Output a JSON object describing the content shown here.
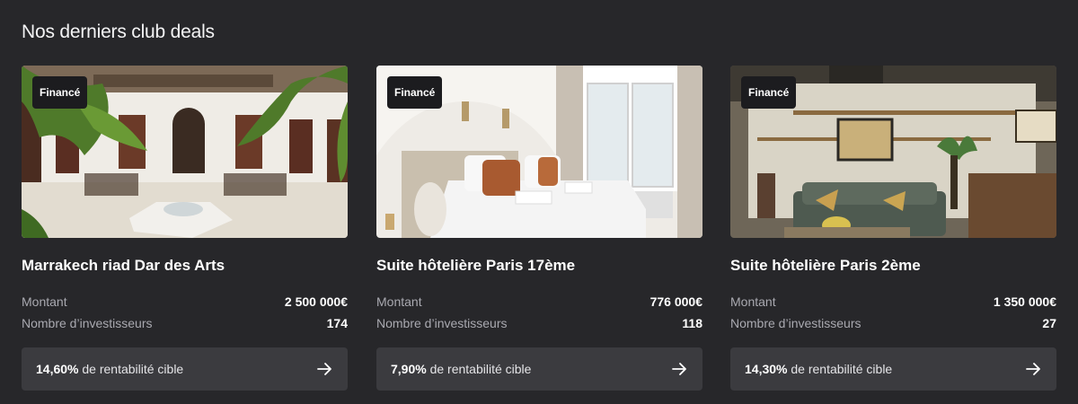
{
  "section": {
    "title": "Nos derniers club deals"
  },
  "labels": {
    "amount": "Montant",
    "investors": "Nombre d’investisseurs",
    "return_suffix": "de rentabilité cible"
  },
  "cards": [
    {
      "badge": "Financé",
      "title": "Marrakech riad Dar des Arts",
      "amount": "2 500 000€",
      "investors": "174",
      "return_rate": "14,60%",
      "image": "riad-courtyard-photo"
    },
    {
      "badge": "Financé",
      "title": "Suite hôtelière Paris 17ème",
      "amount": "776 000€",
      "investors": "118",
      "return_rate": "7,90%",
      "image": "hotel-bedroom-photo"
    },
    {
      "badge": "Financé",
      "title": "Suite hôtelière Paris 2ème",
      "amount": "1 350 000€",
      "investors": "27",
      "return_rate": "14,30%",
      "image": "living-room-photo"
    }
  ],
  "icons": {
    "cta": "arrow-right-icon"
  },
  "colors": {
    "background": "#27272a",
    "badge_bg": "#1c1c1f",
    "cta_bg": "#3b3b3f",
    "label": "#a9a9b0",
    "text": "#ffffff"
  }
}
